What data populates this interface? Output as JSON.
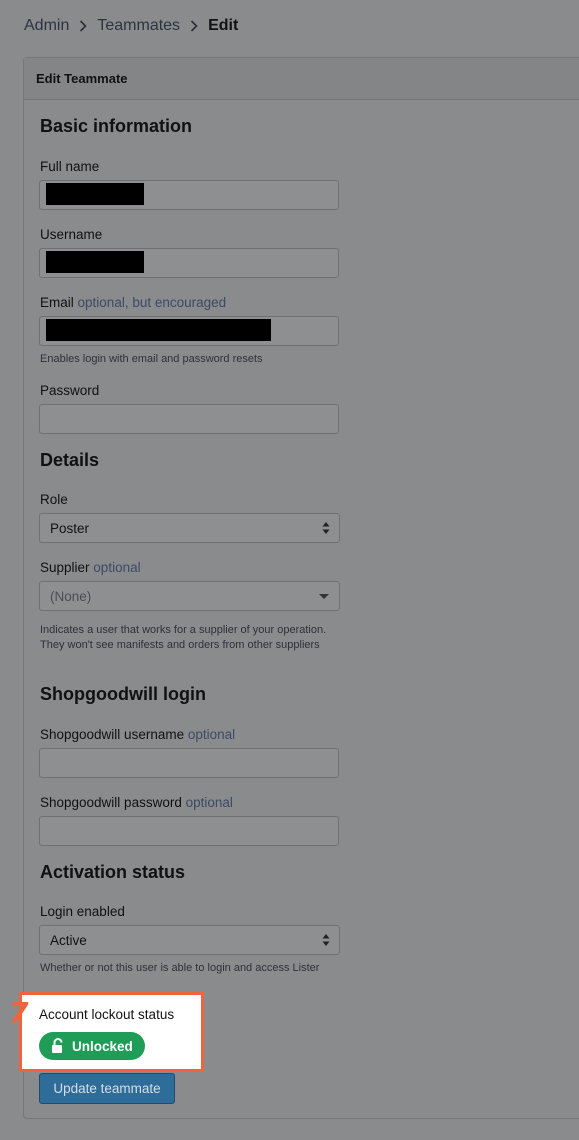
{
  "breadcrumb": {
    "items": [
      "Admin",
      "Teammates"
    ],
    "current": "Edit"
  },
  "card": {
    "title": "Edit Teammate"
  },
  "sections": {
    "basic": "Basic information",
    "details": "Details",
    "shopgoodwill": "Shopgoodwill login",
    "activation": "Activation status"
  },
  "fields": {
    "full_name": {
      "label": "Full name",
      "value_redacted": true
    },
    "username": {
      "label": "Username",
      "value_redacted": true
    },
    "email": {
      "label": "Email",
      "optional_text": "optional, but encouraged",
      "value_redacted": true,
      "help": "Enables login with email and password resets"
    },
    "password": {
      "label": "Password",
      "value": ""
    },
    "role": {
      "label": "Role",
      "value": "Poster"
    },
    "supplier": {
      "label": "Supplier",
      "optional_text": "optional",
      "value": "(None)",
      "help": "Indicates a user that works for a supplier of your operation. They won't see manifests and orders from other suppliers"
    },
    "sgw_username": {
      "label": "Shopgoodwill username",
      "optional_text": "optional",
      "value": ""
    },
    "sgw_password": {
      "label": "Shopgoodwill password",
      "optional_text": "optional",
      "value": ""
    },
    "login_enabled": {
      "label": "Login enabled",
      "value": "Active",
      "help": "Whether or not this user is able to login and access Lister"
    },
    "lockout": {
      "label": "Account lockout status",
      "badge": "Unlocked",
      "badge_color": "#1f9d57"
    }
  },
  "annotation": {
    "marker": "7",
    "color": "#f0643c"
  },
  "actions": {
    "update_label": "Update teammate",
    "update_color": "#2e6c9a"
  },
  "icons": {
    "breadcrumb_separator": "chevron-right-icon",
    "select_arrows": "updown-arrows-icon",
    "lock": "unlock-icon"
  }
}
